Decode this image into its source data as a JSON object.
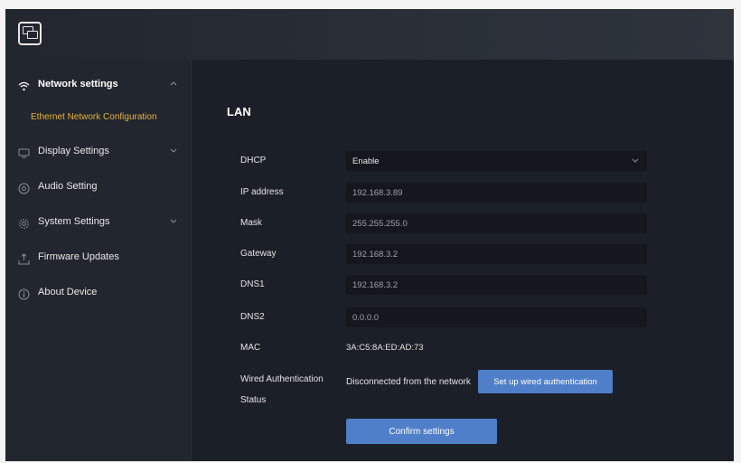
{
  "sidebar": {
    "network": {
      "label": "Network settings",
      "icon": "wifi-icon",
      "chevron": "^"
    },
    "ethernet": {
      "label": "Ethernet Network Configuration"
    },
    "display": {
      "label": "Display Settings",
      "icon": "monitor-icon",
      "chevron": "v"
    },
    "audio": {
      "label": "Audio Setting",
      "icon": "audio-icon"
    },
    "system": {
      "label": "System Settings",
      "icon": "gear-icon",
      "chevron": "v"
    },
    "firmware": {
      "label": "Firmware Updates",
      "icon": "upload-icon"
    },
    "about": {
      "label": "About Device",
      "icon": "info-icon"
    }
  },
  "main": {
    "title": "LAN",
    "dhcp": {
      "label": "DHCP",
      "value": "Enable"
    },
    "ip": {
      "label": "IP address",
      "value": "192.168.3.89"
    },
    "mask": {
      "label": "Mask",
      "value": "255.255.255.0"
    },
    "gateway": {
      "label": "Gateway",
      "value": "192.168.3.2"
    },
    "dns1": {
      "label": "DNS1",
      "value": "192.168.3.2"
    },
    "dns2": {
      "label": "DNS2",
      "value": "0.0.0.0"
    },
    "mac": {
      "label": "MAC",
      "value": "3A:C5:8A:ED:AD:73"
    },
    "auth": {
      "label_line1": "Wired Authentication",
      "label_line2": "Status",
      "status": "Disconnected from the network",
      "button": "Set up wired authentication"
    },
    "confirm_button": "Confirm settings"
  },
  "colors": {
    "accent": "#4f7fc9",
    "active_submenu": "#e8b23a",
    "background": "#1b1f27",
    "sidebar": "#22262e"
  }
}
